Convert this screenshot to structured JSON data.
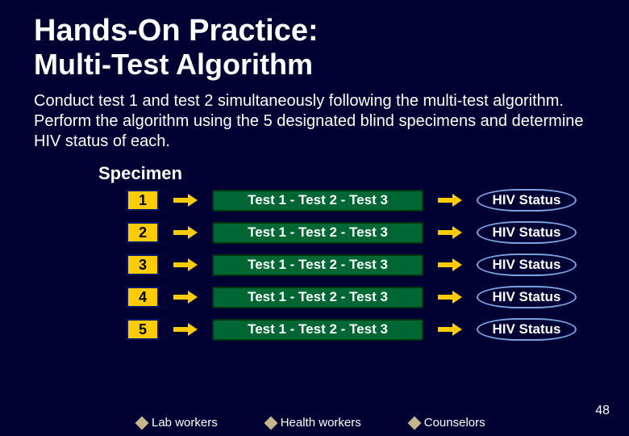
{
  "title_line1": "Hands-On Practice:",
  "title_line2": "Multi-Test Algorithm",
  "body": "Conduct test 1 and test 2 simultaneously following the multi-test algorithm.  Perform the algorithm using the 5 designated blind specimens and determine HIV status of each.",
  "specimen_label": "Specimen",
  "rows": [
    {
      "num": "1",
      "tests": "Test 1  -  Test 2  -  Test 3",
      "status": "HIV Status"
    },
    {
      "num": "2",
      "tests": "Test 1  -  Test 2  -  Test 3",
      "status": "HIV Status"
    },
    {
      "num": "3",
      "tests": "Test 1  -  Test 2  -  Test 3",
      "status": "HIV Status"
    },
    {
      "num": "4",
      "tests": "Test 1  -  Test 2  -  Test 3",
      "status": "HIV Status"
    },
    {
      "num": "5",
      "tests": "Test 1  -  Test 2  -  Test 3",
      "status": "HIV Status"
    }
  ],
  "legend": {
    "a": "Lab workers",
    "b": "Health workers",
    "c": "Counselors"
  },
  "slide_number": "48"
}
